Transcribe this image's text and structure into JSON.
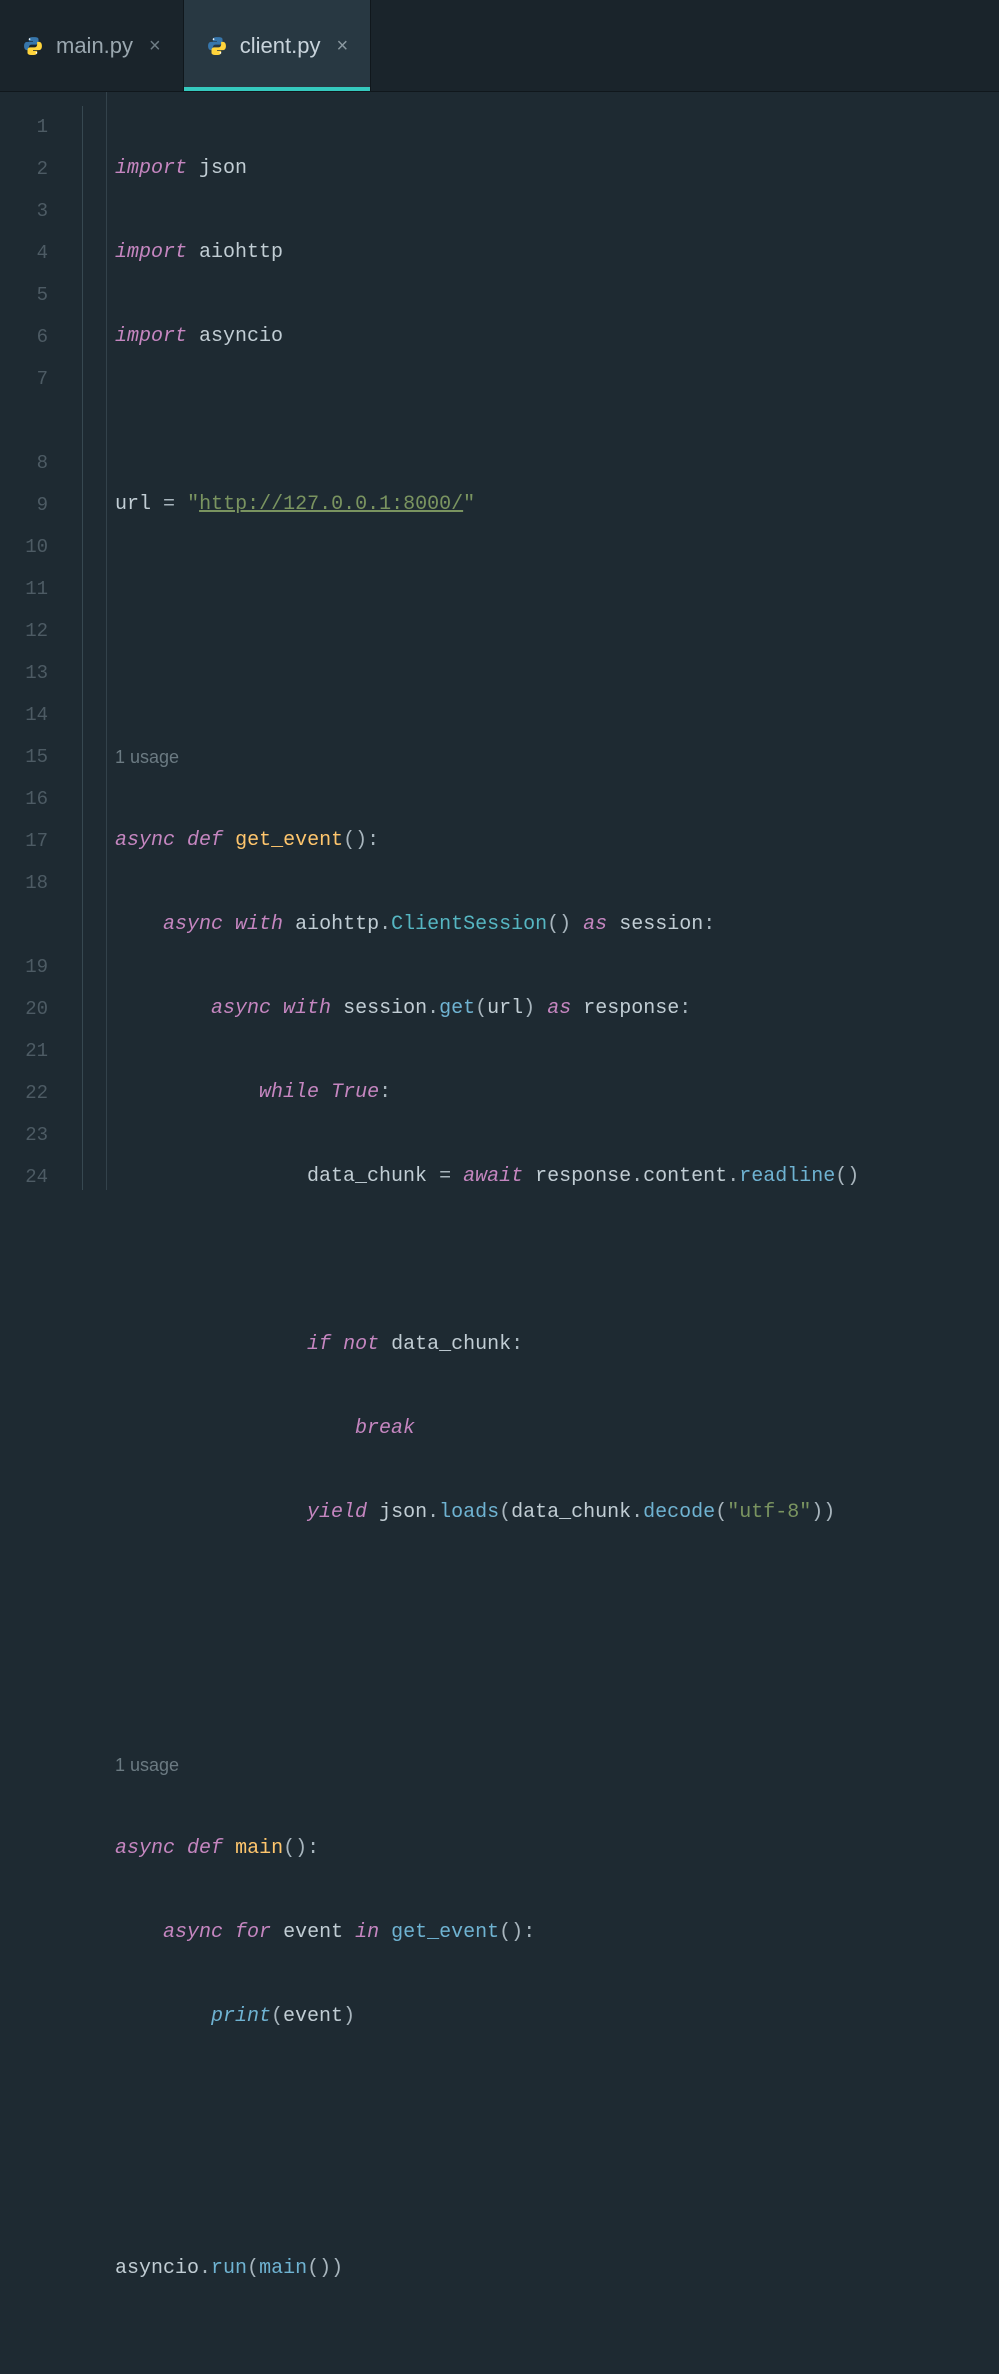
{
  "tabs": [
    {
      "label": "main.py",
      "active": false
    },
    {
      "label": "client.py",
      "active": true
    }
  ],
  "gutter": [
    "1",
    "2",
    "3",
    "4",
    "5",
    "6",
    "7",
    "8",
    "9",
    "10",
    "11",
    "12",
    "13",
    "14",
    "15",
    "16",
    "17",
    "18",
    "19",
    "20",
    "21",
    "22",
    "23",
    "24"
  ],
  "inlays": {
    "above8": "1 usage",
    "above19": "1 usage"
  },
  "code": {
    "l1": {
      "kw": "import",
      "mod": "json"
    },
    "l2": {
      "kw": "import",
      "mod": "aiohttp"
    },
    "l3": {
      "kw": "import",
      "mod": "asyncio"
    },
    "l5": {
      "var": "url",
      "eq": "=",
      "q1": "\"",
      "url": "http://127.0.0.1:8000/",
      "q2": "\""
    },
    "l8": {
      "async": "async",
      "def": "def",
      "name": "get_event",
      "paren": "():"
    },
    "l9": {
      "async": "async",
      "with": "with",
      "mod": "aiohttp",
      "dot": ".",
      "cls": "ClientSession",
      "call": "()",
      "as": "as",
      "v": "session",
      "colon": ":"
    },
    "l10": {
      "async": "async",
      "with": "with",
      "obj": "session",
      "dot": ".",
      "m": "get",
      "lp": "(",
      "arg": "url",
      "rp": ")",
      "as": "as",
      "v": "response",
      "colon": ":"
    },
    "l11": {
      "while": "while",
      "true": "True",
      "colon": ":"
    },
    "l12": {
      "var": "data_chunk",
      "eq": "=",
      "await": "await",
      "obj": "response",
      "d1": ".",
      "p1": "content",
      "d2": ".",
      "m": "readline",
      "call": "()"
    },
    "l14": {
      "if": "if",
      "not": "not",
      "v": "data_chunk",
      "colon": ":"
    },
    "l15": {
      "break": "break"
    },
    "l16": {
      "yield": "yield",
      "mod": "json",
      "d1": ".",
      "m1": "loads",
      "lp": "(",
      "v": "data_chunk",
      "d2": ".",
      "m2": "decode",
      "lp2": "(",
      "s": "\"utf-8\"",
      "rp2": ")",
      "rp": ")"
    },
    "l19": {
      "async": "async",
      "def": "def",
      "name": "main",
      "paren": "():"
    },
    "l20": {
      "async": "async",
      "for": "for",
      "v": "event",
      "in": "in",
      "fn": "get_event",
      "call": "()",
      "colon": ":"
    },
    "l21": {
      "print": "print",
      "lp": "(",
      "v": "event",
      "rp": ")"
    },
    "l24": {
      "mod": "asyncio",
      "d": ".",
      "m": "run",
      "lp": "(",
      "fn": "main",
      "call": "()",
      "rp": ")"
    }
  }
}
